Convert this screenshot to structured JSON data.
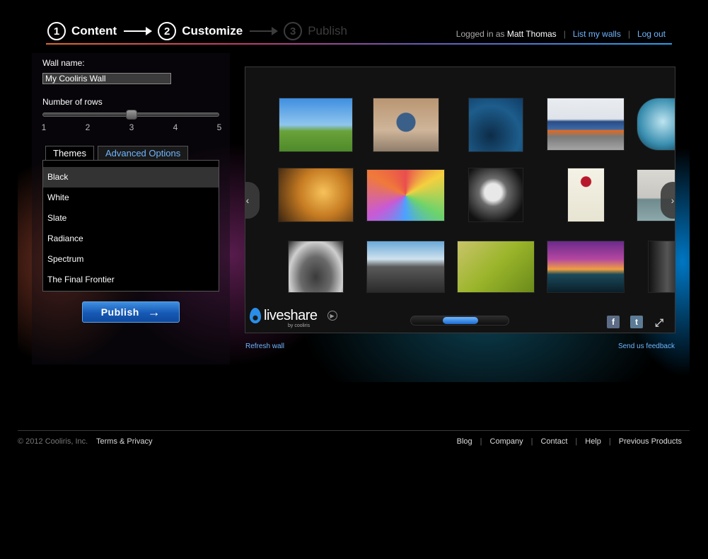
{
  "wizard": {
    "steps": [
      {
        "number": "1",
        "label": "Content",
        "state": "done"
      },
      {
        "number": "2",
        "label": "Customize",
        "state": "active"
      },
      {
        "number": "3",
        "label": "Publish",
        "state": "disabled"
      }
    ]
  },
  "user_nav": {
    "logged_in_prefix": "Logged in as",
    "user_name": "Matt Thomas",
    "list_walls": "List my walls",
    "log_out": "Log out",
    "separator": "|"
  },
  "form": {
    "wall_name_label": "Wall name:",
    "wall_name_value": "My Cooliris Wall",
    "rows_label": "Number of rows",
    "rows_ticks": [
      "1",
      "2",
      "3",
      "4",
      "5"
    ],
    "rows_value": 3
  },
  "tabs": {
    "themes": "Themes",
    "advanced": "Advanced Options"
  },
  "themes": {
    "items": [
      "Black",
      "White",
      "Slate",
      "Radiance",
      "Spectrum",
      "The Final Frontier"
    ],
    "selected": "Black"
  },
  "publish_button": {
    "label": "Publish",
    "arrow": "→"
  },
  "preview": {
    "brand": "liveshare",
    "brand_sub": "by cooliris",
    "nav_prev": "‹",
    "nav_next": "›",
    "facebook": "f",
    "twitter": "t",
    "expand": "⤢"
  },
  "links": {
    "refresh_wall": "Refresh wall",
    "send_feedback": "Send us feedback"
  },
  "footer": {
    "copyright": "© 2012 Cooliris, Inc.",
    "terms": "Terms & Privacy",
    "links": [
      "Blog",
      "Company",
      "Contact",
      "Help",
      "Previous Products"
    ]
  },
  "colors": {
    "accent_link": "#6fb6ff",
    "publish_blue": "#1659b5",
    "background": "#000000"
  }
}
